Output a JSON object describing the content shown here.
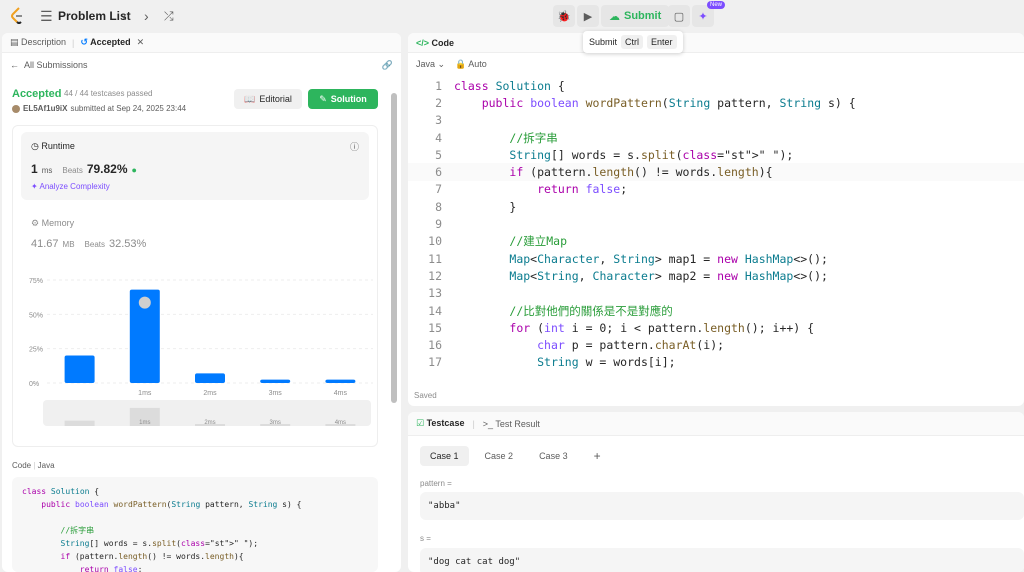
{
  "topbar": {
    "title": "Problem List",
    "submit_label": "Submit",
    "new_badge": "New"
  },
  "tooltip": {
    "label": "Submit",
    "key1": "Ctrl",
    "key2": "Enter"
  },
  "left": {
    "tab_description": "Description",
    "tab_accepted": "Accepted",
    "all_submissions": "All Submissions",
    "status": "Accepted",
    "testcases": "44 / 44 testcases passed",
    "user": "EL5Af1u9iX",
    "submitted": "submitted at Sep 24, 2025 23:44",
    "editorial": "Editorial",
    "solution": "Solution",
    "runtime_title": "Runtime",
    "runtime_value": "1",
    "runtime_unit": "ms",
    "runtime_beats_label": "Beats",
    "runtime_beats": "79.82%",
    "analyze": "Analyze Complexity",
    "memory_title": "Memory",
    "memory_value": "41.67",
    "memory_unit": "MB",
    "memory_beats_label": "Beats",
    "memory_beats": "32.53%",
    "code_label": "Code",
    "code_lang": "Java",
    "code_preview": [
      "class Solution {",
      "    public boolean wordPattern(String pattern, String s) {",
      "",
      "        //拆字串",
      "        String[] words = s.split(\" \");",
      "        if (pattern.length() != words.length){",
      "            return false;"
    ]
  },
  "chart_data": {
    "type": "bar",
    "ytick_labels": [
      "75%",
      "50%",
      "25%",
      "0%"
    ],
    "yticks": [
      75,
      50,
      25,
      0
    ],
    "ylim": [
      0,
      75
    ],
    "x_labels": [
      "",
      "1ms",
      "2ms",
      "3ms",
      "4ms"
    ],
    "values": [
      20,
      68,
      7,
      2.5,
      2.5
    ],
    "highlight_index": 1
  },
  "editor": {
    "title": "Code",
    "lang": "Java",
    "mode": "Auto",
    "saved": "Saved",
    "lines": [
      "class Solution {",
      "    public boolean wordPattern(String pattern, String s) {",
      "",
      "        //拆字串",
      "        String[] words = s.split(\" \");",
      "        if (pattern.length() != words.length){",
      "            return false;",
      "        }",
      "",
      "        //建立Map",
      "        Map<Character, String> map1 = new HashMap<>();",
      "        Map<String, Character> map2 = new HashMap<>();",
      "",
      "        //比對他們的關係是不是對應的",
      "        for (int i = 0; i < pattern.length(); i++) {",
      "            char p = pattern.charAt(i);",
      "            String w = words[i];"
    ]
  },
  "testcase": {
    "tab_testcase": "Testcase",
    "tab_result": "Test Result",
    "cases": [
      "Case 1",
      "Case 2",
      "Case 3"
    ],
    "add": "+",
    "pattern_label": "pattern =",
    "pattern_value": "\"abba\"",
    "s_label": "s =",
    "s_value": "\"dog cat cat dog\""
  },
  "colors": {
    "accent_green": "#2db55d",
    "bar_blue": "#007aff",
    "purple": "#7c4dff"
  }
}
